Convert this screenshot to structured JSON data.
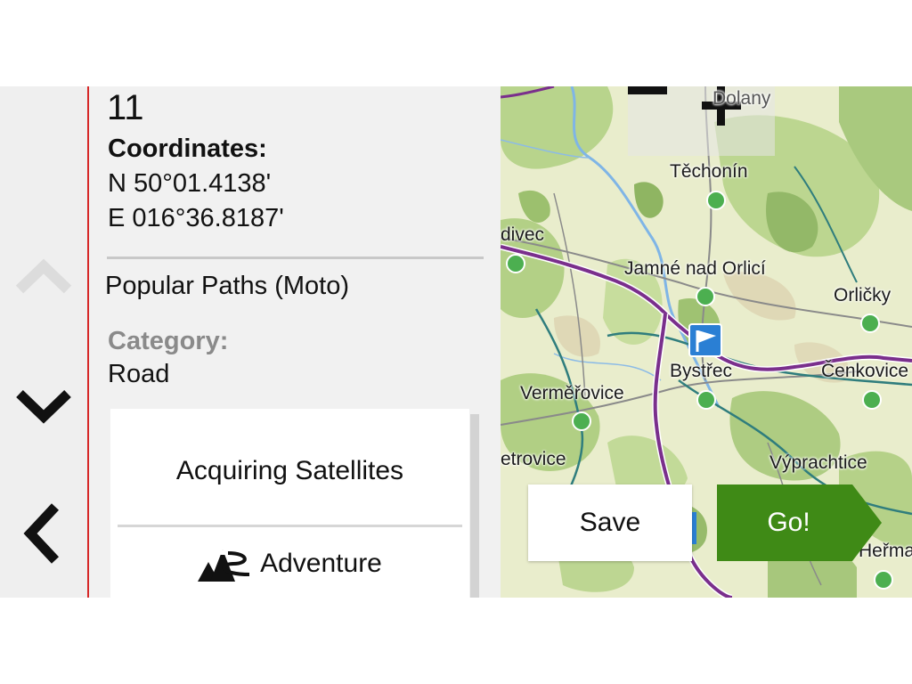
{
  "nav": {
    "up_icon": "chevron-up-icon",
    "down_icon": "chevron-down-icon",
    "back_icon": "chevron-left-icon",
    "accent_color": "#d62828"
  },
  "details": {
    "elevation_value": "11",
    "coordinates_label": "Coordinates:",
    "latitude": "N 50°01.4138'",
    "longitude": "E 016°36.8187'",
    "source": "Popular Paths (Moto)",
    "category_label": "Category:",
    "category_value": "Road"
  },
  "actions": {
    "status": "Acquiring Satellites",
    "routing_mode_label": "Adventure",
    "routing_mode_icon": "adventure-mountain-icon"
  },
  "map": {
    "zoom_out_label": "−",
    "zoom_in_label": "+",
    "places": [
      {
        "name": "Dolany"
      },
      {
        "name": "Těchonín"
      },
      {
        "name": "divec"
      },
      {
        "name": "Jamné nad Orlicí"
      },
      {
        "name": "Orličky"
      },
      {
        "name": "Bystřec"
      },
      {
        "name": "Čenkovice"
      },
      {
        "name": "Verměřovice"
      },
      {
        "name": "etrovice"
      },
      {
        "name": "Výprachtice"
      },
      {
        "name": "Heřma"
      }
    ],
    "save_label": "Save",
    "go_label": "Go!",
    "go_color": "#3f8a16",
    "flag_color": "#2a7fd4"
  }
}
